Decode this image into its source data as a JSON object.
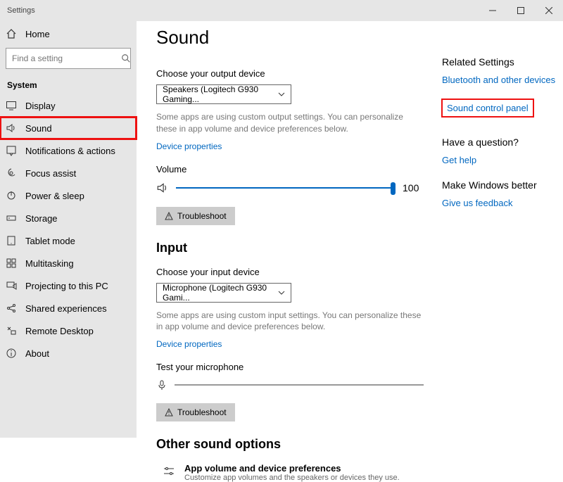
{
  "titlebar": {
    "app_name": "Settings"
  },
  "sidebar": {
    "home_label": "Home",
    "search_placeholder": "Find a setting",
    "section_label": "System",
    "items": [
      {
        "label": "Display",
        "icon": "display-icon"
      },
      {
        "label": "Sound",
        "icon": "sound-icon",
        "highlighted": true
      },
      {
        "label": "Notifications & actions",
        "icon": "notifications-icon"
      },
      {
        "label": "Focus assist",
        "icon": "focus-assist-icon"
      },
      {
        "label": "Power & sleep",
        "icon": "power-icon"
      },
      {
        "label": "Storage",
        "icon": "storage-icon"
      },
      {
        "label": "Tablet mode",
        "icon": "tablet-icon"
      },
      {
        "label": "Multitasking",
        "icon": "multitasking-icon"
      },
      {
        "label": "Projecting to this PC",
        "icon": "projecting-icon"
      },
      {
        "label": "Shared experiences",
        "icon": "shared-icon"
      },
      {
        "label": "Remote Desktop",
        "icon": "remote-desktop-icon"
      },
      {
        "label": "About",
        "icon": "about-icon"
      }
    ]
  },
  "main": {
    "title": "Sound",
    "output": {
      "choose_label": "Choose your output device",
      "selected": "Speakers (Logitech G930 Gaming...",
      "help": "Some apps are using custom output settings. You can personalize these in app volume and device preferences below.",
      "device_properties": "Device properties",
      "volume_label": "Volume",
      "volume_value": "100",
      "volume_percent": 100,
      "troubleshoot": "Troubleshoot"
    },
    "input": {
      "heading": "Input",
      "choose_label": "Choose your input device",
      "selected": "Microphone (Logitech G930 Gami...",
      "help": "Some apps are using custom input settings. You can personalize these in app volume and device preferences below.",
      "device_properties": "Device properties",
      "test_label": "Test your microphone",
      "troubleshoot": "Troubleshoot"
    },
    "other": {
      "heading": "Other sound options",
      "item1_title": "App volume and device preferences",
      "item1_sub": "Customize app volumes and the speakers or devices they use."
    }
  },
  "right": {
    "related_heading": "Related Settings",
    "bluetooth_link": "Bluetooth and other devices",
    "sound_control_panel": "Sound control panel",
    "question_heading": "Have a question?",
    "get_help": "Get help",
    "better_heading": "Make Windows better",
    "feedback": "Give us feedback"
  }
}
